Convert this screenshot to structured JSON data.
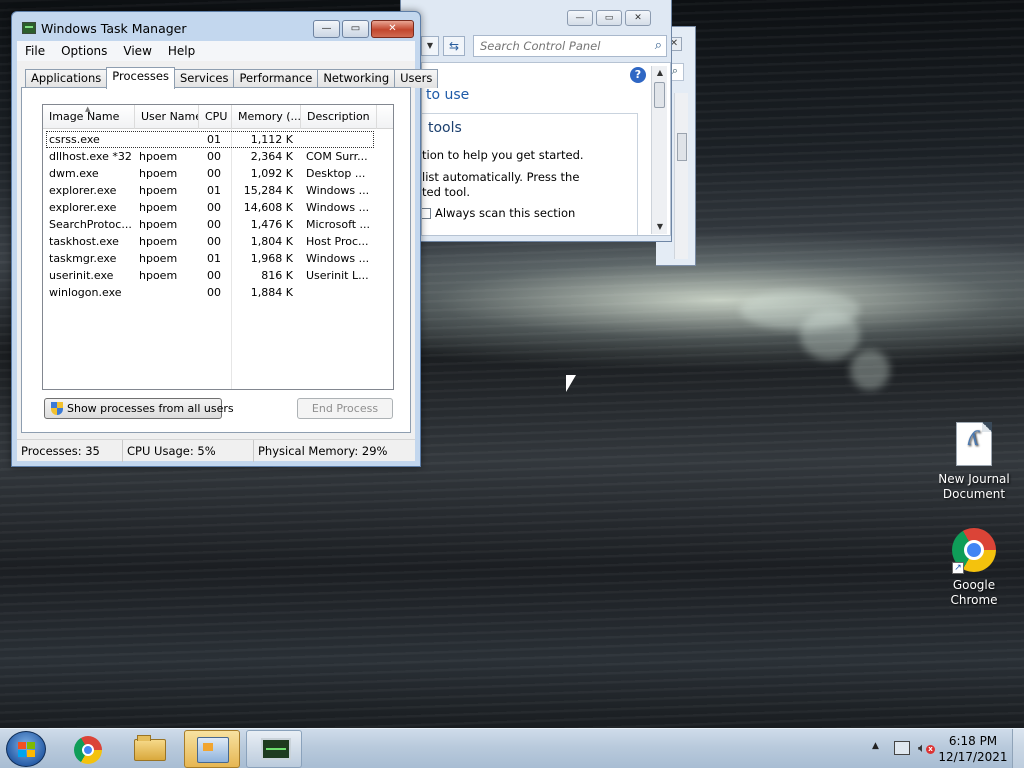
{
  "control_panel": {
    "search_placeholder": "Search Control Panel",
    "help_label": "?",
    "heading_partial": "to use",
    "group_heading_partial": "tools",
    "line1": "tion to help you get started.",
    "line2": "list automatically.  Press the",
    "line3": "ted tool.",
    "checkbox_label": "Always scan this section",
    "caption_buttons": [
      "—",
      "▭",
      "✕"
    ]
  },
  "task_manager": {
    "title": "Windows Task Manager",
    "caption_buttons": [
      "—",
      "▭",
      "✕"
    ],
    "menu": [
      "File",
      "Options",
      "View",
      "Help"
    ],
    "tabs": [
      "Applications",
      "Processes",
      "Services",
      "Performance",
      "Networking",
      "Users"
    ],
    "active_tab": "Processes",
    "columns": [
      "Image Name",
      "User Name",
      "CPU",
      "Memory (...",
      "Description"
    ],
    "rows": [
      {
        "name": "csrss.exe",
        "user": "",
        "cpu": "01",
        "mem": "1,112 K",
        "desc": ""
      },
      {
        "name": "dllhost.exe *32",
        "user": "hpoem",
        "cpu": "00",
        "mem": "2,364 K",
        "desc": "COM Surr..."
      },
      {
        "name": "dwm.exe",
        "user": "hpoem",
        "cpu": "00",
        "mem": "1,092 K",
        "desc": "Desktop ..."
      },
      {
        "name": "explorer.exe",
        "user": "hpoem",
        "cpu": "01",
        "mem": "15,284 K",
        "desc": "Windows ..."
      },
      {
        "name": "explorer.exe",
        "user": "hpoem",
        "cpu": "00",
        "mem": "14,608 K",
        "desc": "Windows ..."
      },
      {
        "name": "SearchProtoc...",
        "user": "hpoem",
        "cpu": "00",
        "mem": "1,476 K",
        "desc": "Microsoft ..."
      },
      {
        "name": "taskhost.exe",
        "user": "hpoem",
        "cpu": "00",
        "mem": "1,804 K",
        "desc": "Host Proc..."
      },
      {
        "name": "taskmgr.exe",
        "user": "hpoem",
        "cpu": "01",
        "mem": "1,968 K",
        "desc": "Windows ..."
      },
      {
        "name": "userinit.exe",
        "user": "hpoem",
        "cpu": "00",
        "mem": "816 K",
        "desc": "Userinit L..."
      },
      {
        "name": "winlogon.exe",
        "user": "",
        "cpu": "00",
        "mem": "1,884 K",
        "desc": ""
      }
    ],
    "show_all_label": "Show processes from all users",
    "end_process_label": "End Process",
    "status": {
      "processes": "Processes: 35",
      "cpu": "CPU Usage: 5%",
      "memory": "Physical Memory: 29%"
    }
  },
  "desktop_icons": [
    {
      "label_line1": "New Journal",
      "label_line2": "Document",
      "icon": "journal-document-icon"
    },
    {
      "label_line1": "Google",
      "label_line2": "Chrome",
      "icon": "chrome-icon"
    }
  ],
  "taskbar": {
    "pinned": [
      "chrome-icon",
      "windows-explorer-icon",
      "control-panel-icon",
      "task-manager-icon"
    ],
    "time": "6:18 PM",
    "date": "12/17/2021"
  },
  "colors": {
    "taskbar": "#b9cadc",
    "window_frame": "#c3d7ee",
    "link_blue": "#1e5aa8",
    "close_button": "#c2462d"
  }
}
